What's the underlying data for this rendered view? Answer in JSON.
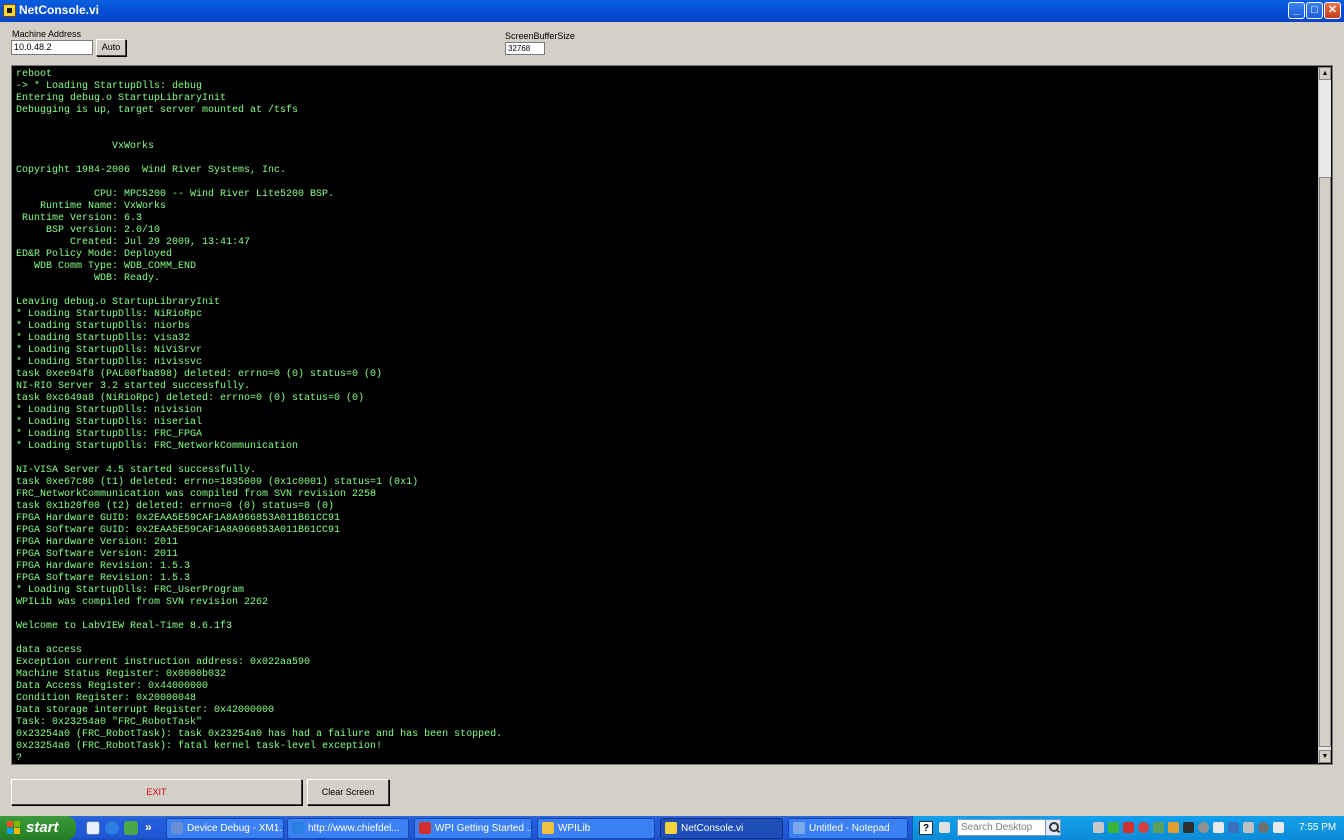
{
  "window": {
    "title": "NetConsole.vi",
    "minimize_glyph": "_",
    "maximize_glyph": "□",
    "close_glyph": "✕"
  },
  "controls": {
    "machine_address_label": "Machine Address",
    "machine_address_value": "10.0.48.2",
    "auto_button_label": "Auto",
    "buffer_size_label": "ScreenBufferSize",
    "buffer_size_value": "32768"
  },
  "console": {
    "text_color": "#88ff88",
    "background": "#000000",
    "lines": [
      "reboot",
      "-> * Loading StartupDlls: debug",
      "Entering debug.o StartupLibraryInit",
      "Debugging is up, target server mounted at /tsfs",
      "",
      "",
      "                VxWorks",
      "",
      "Copyright 1984-2006  Wind River Systems, Inc.",
      "",
      "             CPU: MPC5200 -- Wind River Lite5200 BSP.",
      "    Runtime Name: VxWorks",
      " Runtime Version: 6.3",
      "     BSP version: 2.0/10",
      "         Created: Jul 29 2009, 13:41:47",
      "ED&R Policy Mode: Deployed",
      "   WDB Comm Type: WDB_COMM_END",
      "             WDB: Ready.",
      "",
      "Leaving debug.o StartupLibraryInit",
      "* Loading StartupDlls: NiRioRpc",
      "* Loading StartupDlls: niorbs",
      "* Loading StartupDlls: visa32",
      "* Loading StartupDlls: NiViSrvr",
      "* Loading StartupDlls: nivissvc",
      "task 0xee94f8 (PAL00fba898) deleted: errno=0 (0) status=0 (0)",
      "NI-RIO Server 3.2 started successfully.",
      "task 0xc649a8 (NiRioRpc) deleted: errno=0 (0) status=0 (0)",
      "* Loading StartupDlls: nivision",
      "* Loading StartupDlls: niserial",
      "* Loading StartupDlls: FRC_FPGA",
      "* Loading StartupDlls: FRC_NetworkCommunication",
      "",
      "NI-VISA Server 4.5 started successfully.",
      "task 0xe67c80 (t1) deleted: errno=1835009 (0x1c0001) status=1 (0x1)",
      "FRC_NetworkCommunication was compiled from SVN revision 2258",
      "task 0x1b20f00 (t2) deleted: errno=0 (0) status=0 (0)",
      "FPGA Hardware GUID: 0x2EAA5E59CAF1A8A966853A011B61CC91",
      "FPGA Software GUID: 0x2EAA5E59CAF1A8A966853A011B61CC91",
      "FPGA Hardware Version: 2011",
      "FPGA Software Version: 2011",
      "FPGA Hardware Revision: 1.5.3",
      "FPGA Software Revision: 1.5.3",
      "* Loading StartupDlls: FRC_UserProgram",
      "WPILib was compiled from SVN revision 2262",
      "",
      "Welcome to LabVIEW Real-Time 8.6.1f3",
      "",
      "data access",
      "Exception current instruction address: 0x022aa590",
      "Machine Status Register: 0x0000b032",
      "Data Access Register: 0x44000000",
      "Condition Register: 0x20000048",
      "Data storage interrupt Register: 0x42000000",
      "Task: 0x23254a0 \"FRC_RobotTask\"",
      "0x23254a0 (FRC_RobotTask): task 0x23254a0 has had a failure and has been stopped.",
      "0x23254a0 (FRC_RobotTask): fatal kernel task-level exception!",
      "?"
    ]
  },
  "buttons": {
    "exit_label": "EXIT",
    "clear_label": "Clear Screen"
  },
  "taskbar": {
    "start_label": "start",
    "overflow_glyph": "»",
    "items": [
      {
        "label": "Device Debug - XM1...",
        "icon_color": "#6b8fd6",
        "active": false
      },
      {
        "label": "http://www.chiefdel...",
        "icon_color": "#2a7fe0",
        "active": false
      },
      {
        "label": "WPI Getting Started ...",
        "icon_color": "#d03030",
        "active": false
      },
      {
        "label": "WPILib",
        "icon_color": "#f0c040",
        "active": false
      },
      {
        "label": "NetConsole.vi",
        "icon_color": "#f7d23a",
        "active": true
      },
      {
        "label": "Untitled - Notepad",
        "icon_color": "#7aa8e8",
        "active": false
      }
    ],
    "help_glyph": "?",
    "search_placeholder": "Search Desktop",
    "clock": "7:55 PM"
  }
}
